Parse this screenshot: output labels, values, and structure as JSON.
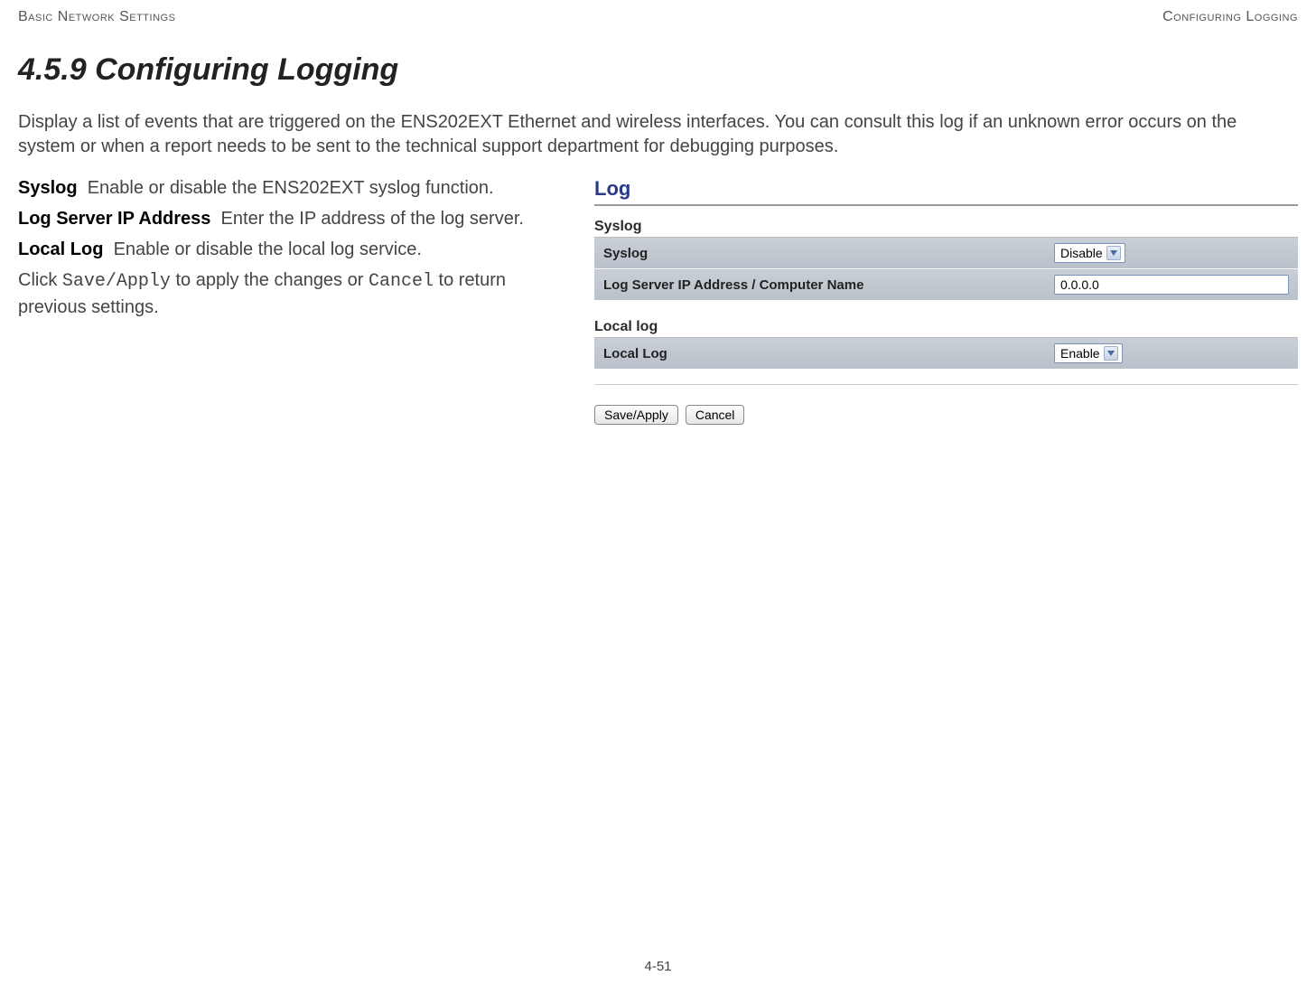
{
  "header": {
    "left": "Basic Network Settings",
    "right": "Configuring Logging"
  },
  "heading": "4.5.9 Configuring Logging",
  "intro": "Display a list of events that are triggered on the ENS202EXT Ethernet and wireless interfaces. You can consult this log if an unknown error occurs on the system or when a report needs to be sent to the technical support department for debugging purposes.",
  "definitions": {
    "syslog": {
      "term": "Syslog",
      "desc": "Enable or disable the ENS202EXT syslog function."
    },
    "logserver": {
      "term": "Log Server IP Address",
      "desc": "Enter the IP address of the log server."
    },
    "locallog": {
      "term": "Local Log",
      "desc": "Enable or disable the local log service."
    }
  },
  "instruction": {
    "prefix": "Click ",
    "save": "Save/Apply",
    "mid": " to apply the changes or ",
    "cancel": "Cancel",
    "suffix": " to return previous settings."
  },
  "panel": {
    "title": "Log",
    "syslog_group": "Syslog",
    "syslog_row": "Syslog",
    "syslog_value": "Disable",
    "ip_row": "Log Server IP Address / Computer Name",
    "ip_value": "0.0.0.0",
    "locallog_group": "Local log",
    "locallog_row": "Local Log",
    "locallog_value": "Enable",
    "save_button": "Save/Apply",
    "cancel_button": "Cancel"
  },
  "footer": "4-51"
}
